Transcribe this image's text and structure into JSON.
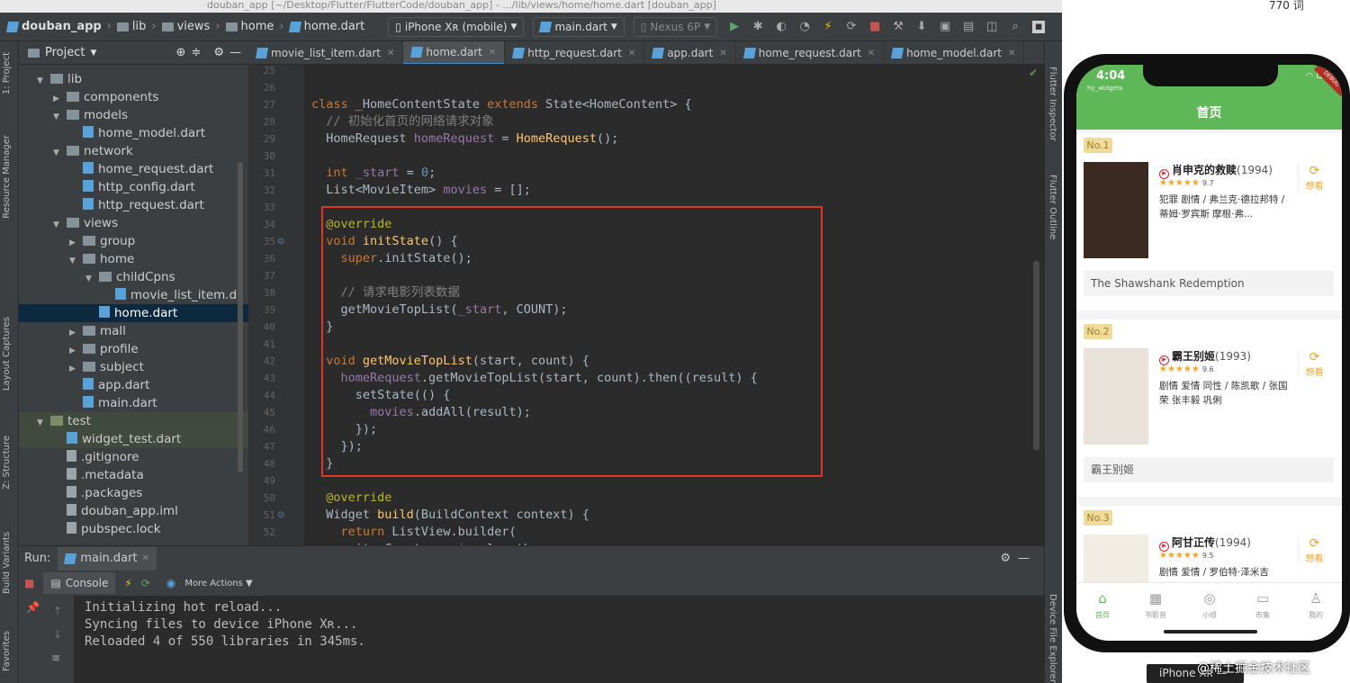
{
  "titlebar": {
    "text": "douban_app [~/Desktop/Flutter/FlutterCode/douban_app] - .../lib/views/home/home.dart [douban_app]",
    "word_count": "770 词"
  },
  "toolbar": {
    "breadcrumb": [
      "douban_app",
      "lib",
      "views",
      "home",
      "home.dart"
    ],
    "device": "iPhone Xʀ (mobile)",
    "run_config": "main.dart",
    "avd": "Nexus 6P"
  },
  "left_strip": {
    "tabs": [
      "1: Project",
      "Resource Manager",
      "Layout Captures",
      "Z: Structure",
      "Build Variants",
      "Favorites"
    ]
  },
  "project_panel": {
    "title": "Project",
    "tree": [
      {
        "label": "lib",
        "indent": 0,
        "kind": "folder",
        "open": true
      },
      {
        "label": "components",
        "indent": 1,
        "kind": "folder",
        "open": false
      },
      {
        "label": "models",
        "indent": 1,
        "kind": "folder",
        "open": true
      },
      {
        "label": "home_model.dart",
        "indent": 2,
        "kind": "dart"
      },
      {
        "label": "network",
        "indent": 1,
        "kind": "folder",
        "open": true
      },
      {
        "label": "home_request.dart",
        "indent": 2,
        "kind": "dart"
      },
      {
        "label": "http_config.dart",
        "indent": 2,
        "kind": "dart"
      },
      {
        "label": "http_request.dart",
        "indent": 2,
        "kind": "dart"
      },
      {
        "label": "views",
        "indent": 1,
        "kind": "folder",
        "open": true
      },
      {
        "label": "group",
        "indent": 2,
        "kind": "folder",
        "open": false
      },
      {
        "label": "home",
        "indent": 2,
        "kind": "folder",
        "open": true
      },
      {
        "label": "childCpns",
        "indent": 3,
        "kind": "folder",
        "open": true
      },
      {
        "label": "movie_list_item.d",
        "indent": 4,
        "kind": "dart"
      },
      {
        "label": "home.dart",
        "indent": 3,
        "kind": "dart",
        "selected": true
      },
      {
        "label": "mall",
        "indent": 2,
        "kind": "folder",
        "open": false
      },
      {
        "label": "profile",
        "indent": 2,
        "kind": "folder",
        "open": false
      },
      {
        "label": "subject",
        "indent": 2,
        "kind": "folder",
        "open": false
      },
      {
        "label": "app.dart",
        "indent": 2,
        "kind": "dart"
      },
      {
        "label": "main.dart",
        "indent": 2,
        "kind": "dart"
      },
      {
        "label": "test",
        "indent": 0,
        "kind": "folder",
        "open": true,
        "test": true
      },
      {
        "label": "widget_test.dart",
        "indent": 1,
        "kind": "dart",
        "test": true
      },
      {
        "label": ".gitignore",
        "indent": 1,
        "kind": "file"
      },
      {
        "label": ".metadata",
        "indent": 1,
        "kind": "file"
      },
      {
        "label": ".packages",
        "indent": 1,
        "kind": "file"
      },
      {
        "label": "douban_app.iml",
        "indent": 1,
        "kind": "file"
      },
      {
        "label": "pubspec.lock",
        "indent": 1,
        "kind": "file"
      }
    ]
  },
  "editor_tabs": [
    "movie_list_item.dart",
    "home.dart",
    "http_request.dart",
    "app.dart",
    "home_request.dart",
    "home_model.dart"
  ],
  "editor": {
    "lines": [
      {
        "n": "25",
        "html": ""
      },
      {
        "n": "26",
        "html": ""
      },
      {
        "n": "27",
        "html": "<span class='kw'>class </span>_HomeContentState <span class='kw'>extends </span>State&lt;HomeContent&gt; {"
      },
      {
        "n": "28",
        "html": "  <span class='cm'>// 初始化首页的网络请求对象</span>"
      },
      {
        "n": "29",
        "html": "  HomeRequest <span class='fld'>homeRequest</span> = <span class='fn'>HomeRequest</span>();"
      },
      {
        "n": "30",
        "html": ""
      },
      {
        "n": "31",
        "html": "  <span class='kw'>int </span><span class='fld'>_start</span> = <span class='num'>0</span>;"
      },
      {
        "n": "32",
        "html": "  List&lt;MovieItem&gt; <span class='fld'>movies</span> = [];"
      },
      {
        "n": "33",
        "html": ""
      },
      {
        "n": "34",
        "html": "  <span class='an'>@override</span>"
      },
      {
        "n": "35",
        "html": "  <span class='kw'>void </span><span class='fn'>initState</span>() {"
      },
      {
        "n": "36",
        "html": "    <span class='kw'>super</span>.initState();"
      },
      {
        "n": "37",
        "html": ""
      },
      {
        "n": "38",
        "html": "    <span class='cm'>// 请求电影列表数据</span>"
      },
      {
        "n": "39",
        "html": "    getMovieTopList(<span class='fld'>_start</span>, COUNT);"
      },
      {
        "n": "40",
        "html": "  }"
      },
      {
        "n": "41",
        "html": ""
      },
      {
        "n": "42",
        "html": "  <span class='kw'>void </span><span class='fn'>getMovieTopList</span>(start, count) {"
      },
      {
        "n": "43",
        "html": "    <span class='fld'>homeRequest</span>.getMovieTopList(start, count).then((result) {"
      },
      {
        "n": "44",
        "html": "      setState(() {"
      },
      {
        "n": "45",
        "html": "        <span class='fld'>movies</span>.addAll(result);"
      },
      {
        "n": "46",
        "html": "      });"
      },
      {
        "n": "47",
        "html": "    });"
      },
      {
        "n": "48",
        "html": "  }"
      },
      {
        "n": "49",
        "html": ""
      },
      {
        "n": "50",
        "html": "  <span class='an'>@override</span>"
      },
      {
        "n": "51",
        "html": "  Widget <span class='fn'>build</span>(BuildContext context) {"
      },
      {
        "n": "52",
        "html": "    <span class='kw'>return </span>ListView.builder("
      },
      {
        "n": "53",
        "html": "      itemCount: <span class='fld'>movies</span>.length,"
      }
    ]
  },
  "right_strip": {
    "tabs": [
      "Flutter Inspector",
      "Flutter Outline",
      "Device File Explorer"
    ]
  },
  "run": {
    "label": "Run:",
    "tab": "main.dart",
    "console_tab": "Console",
    "more_actions": "More Actions"
  },
  "console": {
    "lines": [
      "Initializing hot reload...",
      "Syncing files to device iPhone Xʀ...",
      "Reloaded 4 of 550 libraries in 345ms."
    ]
  },
  "phone": {
    "time": "4:04",
    "bundle": "hy_widgets",
    "debug": "DEBUG",
    "app_title": "首页",
    "movies": [
      {
        "rank": "No.1",
        "title": "肖申克的救赎",
        "year": "(1994)",
        "stars": "★★★★★",
        "rating": "9.7",
        "info": "犯罪 剧情 / 弗兰克·德拉邦特 / 蒂姆·罗宾斯 摩根·弗...",
        "wish": "想看",
        "original": "The Shawshank Redemption",
        "poster_color": "#3b2a20"
      },
      {
        "rank": "No.2",
        "title": "霸王别姬",
        "year": "(1993)",
        "stars": "★★★★★",
        "rating": "9.6",
        "info": "剧情 爱情 同性 / 陈凯歌 / 张国荣 张丰毅 巩俐",
        "wish": "想看",
        "original": "霸王别姬",
        "poster_color": "#e9e2da"
      },
      {
        "rank": "No.3",
        "title": "阿甘正传",
        "year": "(1994)",
        "stars": "★★★★★",
        "rating": "9.5",
        "info": "剧情 爱情 / 罗伯特·泽米吉",
        "wish": "想看",
        "original": "",
        "poster_color": "#f1ede4"
      }
    ],
    "nav": [
      "首页",
      "书影音",
      "小组",
      "市集",
      "我的"
    ],
    "device_label": "iPhone Xʀ — 12.4"
  },
  "watermark": "@稀土掘金技术社区",
  "colors": {
    "highlight_box": "#e0332a",
    "appbar_green": "#5fb858",
    "selection": "#0d293e"
  }
}
